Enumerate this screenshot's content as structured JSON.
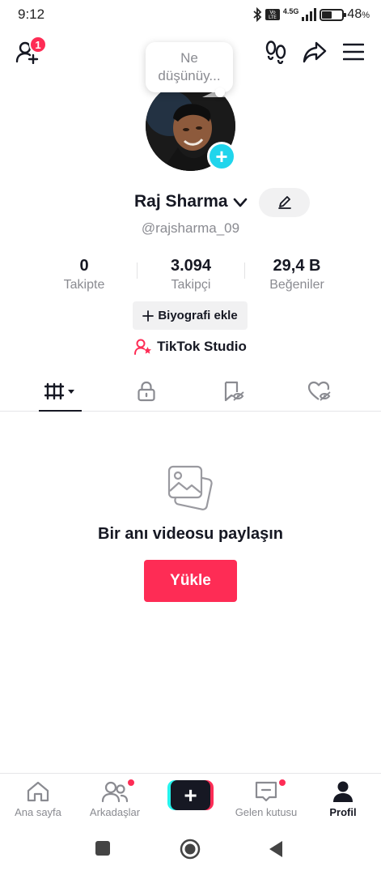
{
  "status_bar": {
    "time": "9:12",
    "network_small": "4.5G",
    "battery_percent": "48",
    "battery_unit": "%",
    "icons": [
      "bluetooth-icon",
      "volte-icon",
      "signal-icon",
      "battery-icon"
    ]
  },
  "header": {
    "add_friends_badge": "1",
    "icons": [
      "add-user-icon",
      "footprints-icon",
      "share-icon",
      "menu-icon"
    ]
  },
  "profile": {
    "thought_bubble": "Ne düşünüy...",
    "name": "Raj Sharma",
    "username": "@rajsharma_09",
    "stats": [
      {
        "value": "0",
        "label": "Takipte"
      },
      {
        "value": "3.094",
        "label": "Takipçi"
      },
      {
        "value": "29,4 B",
        "label": "Beğeniler"
      }
    ],
    "bio_button": "Biyografi ekle",
    "studio_link": "TikTok Studio"
  },
  "tabs": [
    "videos-grid-icon",
    "lock-icon",
    "bookmark-icon",
    "heart-icon"
  ],
  "empty_state": {
    "title": "Bir anı videosu paylaşın",
    "upload_button": "Yükle"
  },
  "bottom_nav": {
    "items": [
      {
        "label": "Ana sayfa",
        "icon": "home-icon"
      },
      {
        "label": "Arkadaşlar",
        "icon": "friends-icon"
      },
      {
        "label": "",
        "icon": "plus-icon"
      },
      {
        "label": "Gelen kutusu",
        "icon": "inbox-icon"
      },
      {
        "label": "Profil",
        "icon": "profile-icon"
      }
    ]
  },
  "colors": {
    "accent": "#fe2c55",
    "cyan": "#20d5ec",
    "text": "#161823",
    "muted": "#8a8b91"
  }
}
